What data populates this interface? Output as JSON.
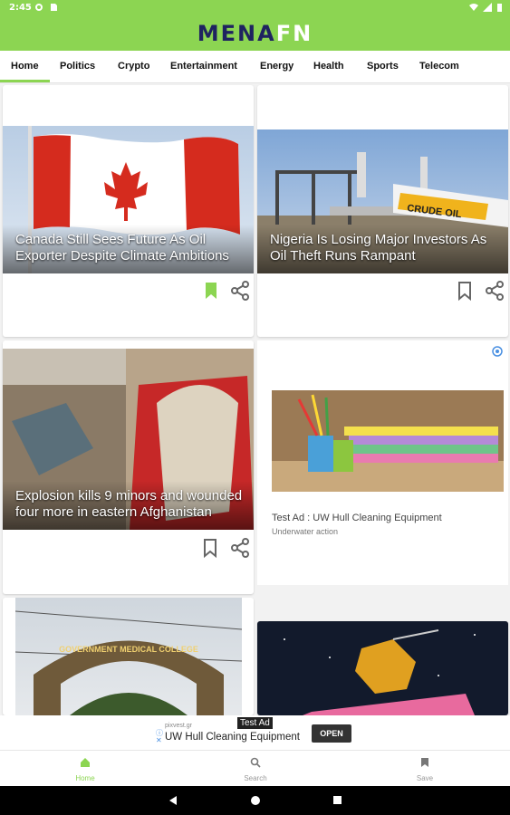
{
  "status": {
    "time": "2:45"
  },
  "brand": {
    "part1": "MENA",
    "part2": "FN",
    "accent": "#8cd552",
    "navy": "#1f2360"
  },
  "tabs": [
    {
      "label": "Home",
      "active": true
    },
    {
      "label": "Politics"
    },
    {
      "label": "Crypto"
    },
    {
      "label": "Entertainment"
    },
    {
      "label": "Energy"
    },
    {
      "label": "Health"
    },
    {
      "label": "Sports"
    },
    {
      "label": "Telecom"
    }
  ],
  "articles": [
    {
      "headline": "Canada Still Sees Future As Oil Exporter Despite Climate Ambitions",
      "bookmarked": true
    },
    {
      "headline": "Nigeria Is Losing Major Investors As Oil Theft Runs Rampant",
      "bookmarked": false,
      "pipe_text": "CRUDE OIL"
    },
    {
      "headline": "Explosion kills 9 minors and wounded four more in eastern Afghanistan",
      "bookmarked": false
    },
    {
      "gate_text": "GOVERNMENT MEDICAL COLLEGE"
    }
  ],
  "ad": {
    "title": "Test Ad : UW Hull Cleaning Equipment",
    "subtitle": "Underwater action"
  },
  "banner": {
    "tag": "Test Ad",
    "domain": "pixvest.gr",
    "text": "UW Hull Cleaning Equipment",
    "button": "OPEN"
  },
  "bottom_nav": [
    {
      "label": "Home",
      "icon": "home-icon",
      "active": true
    },
    {
      "label": "Search",
      "icon": "search-icon"
    },
    {
      "label": "Save",
      "icon": "bookmark-icon"
    }
  ]
}
